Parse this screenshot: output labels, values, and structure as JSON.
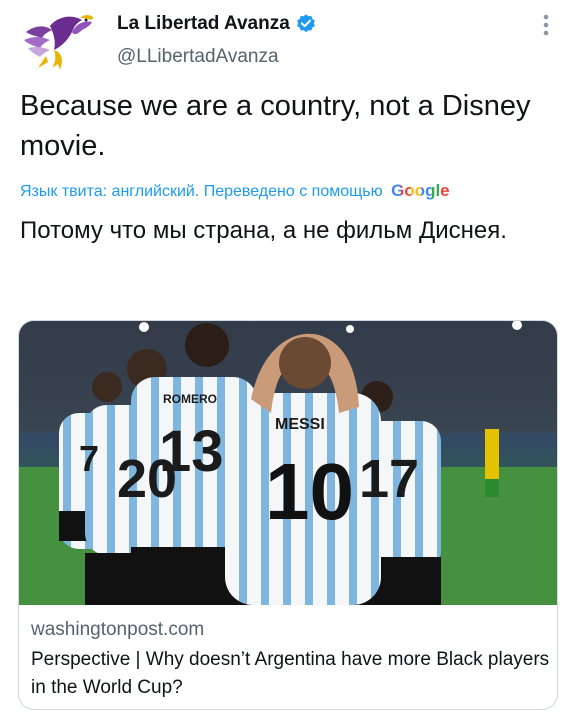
{
  "tweet": {
    "author": {
      "display_name": "La Libertad Avanza",
      "handle": "@LLibertadAvanza",
      "avatar_icon": "eagle-logo-icon",
      "verified_icon": "verified-badge-icon",
      "verified_color": "#1d9bf0"
    },
    "menu_icon": "more-options-icon",
    "text": "Because we are a country, not a Disney movie.",
    "translation": {
      "notice": "Язык твита: английский. Переведено с помощью",
      "provider": "Google",
      "text": "Потому что мы страна, а не фильм Диснея."
    },
    "link_card": {
      "domain": "washingtonpost.com",
      "title": "Perspective | Why doesn’t Argentina have more Black players in the World Cup?",
      "image_labels": {
        "player_1_name": "MESSI",
        "player_1_number": "10",
        "player_2_name": "ROMERO",
        "player_2_number": "13",
        "player_3_number": "20",
        "player_4_number": "17",
        "player_5_number": "7"
      }
    }
  },
  "colors": {
    "accent": "#1d9bf0",
    "secondary_text": "#536471",
    "border": "#cfd9de"
  }
}
